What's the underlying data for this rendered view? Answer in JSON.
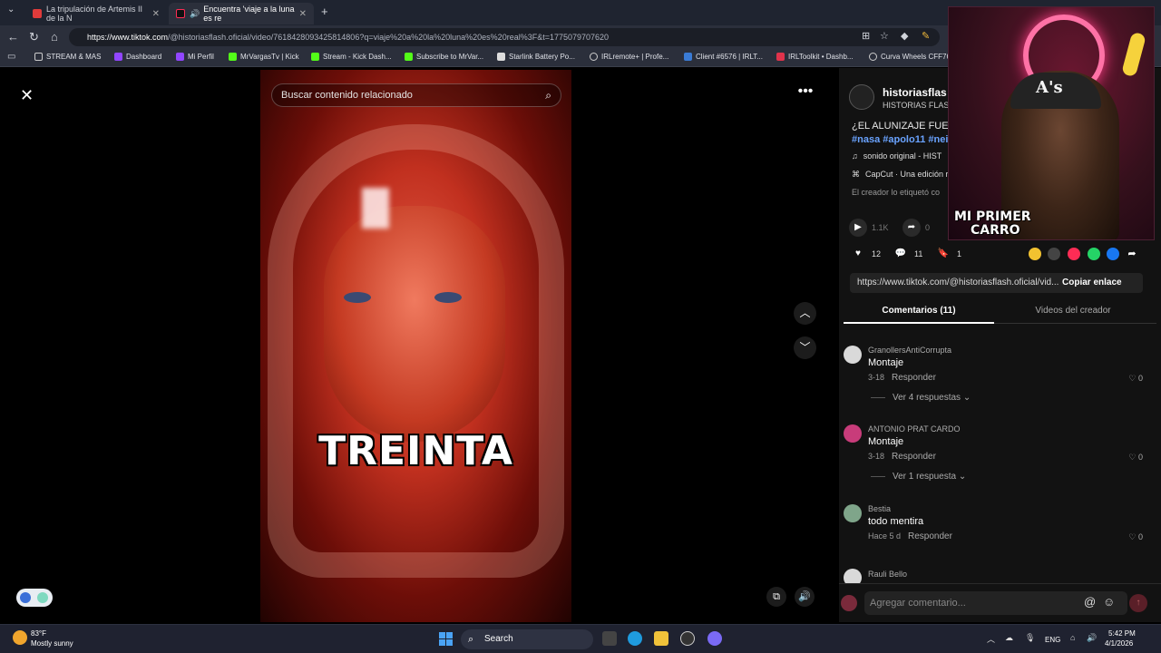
{
  "browser": {
    "tabs": [
      {
        "title": "La tripulación de Artemis II de la N",
        "active": false
      },
      {
        "title": "Encuentra 'viaje a la luna es re",
        "active": true
      }
    ],
    "url_domain": "https://www.tiktok.com",
    "url_path": "/@historiasflash.oficial/video/7618428093425814806?q=viaje%20a%20la%20luna%20es%20real%3F&t=1775079707620",
    "bookmarks": [
      "STREAM & MAS",
      "Dashboard",
      "Mi Perfil",
      "MrVargasTv | Kick",
      "Stream - Kick Dash...",
      "Subscribe to MrVar...",
      "Starlink Battery Po...",
      "IRLremote+ | Profe...",
      "Client #6576 | IRLT...",
      "IRLToolkit • Dashb...",
      "Curva Wheels CFF76"
    ]
  },
  "video": {
    "search_placeholder": "Buscar contenido relacionado",
    "caption": "TREINTA"
  },
  "creator": {
    "name": "historiasflas",
    "subtitle": "HISTORIAS FLAS",
    "description": "¿EL ALUNIZAJE FUE F",
    "hashtags": "#nasa #apolo11 #nei",
    "sound": "sonido original - HIST",
    "capcut": "CapCut · Una edición r",
    "tagged": "El creador lo etiquetó co"
  },
  "stats": {
    "plays": "1.1K",
    "shares": "0",
    "likes": "12",
    "comments": "11",
    "saves": "1"
  },
  "share": {
    "link": "https://www.tiktok.com/@historiasflash.oficial/vid...",
    "copy_label": "Copiar enlace"
  },
  "panel_tabs": {
    "comments": "Comentarios (11)",
    "creator_videos": "Videos del creador"
  },
  "comments": [
    {
      "user": "GranollersAntiCorrupta",
      "text": "Montaje",
      "date": "3-18",
      "reply": "Responder",
      "likes": "0",
      "more": "Ver 4 respuestas ⌄",
      "avatar_color": "#d9d9d9"
    },
    {
      "user": "ANTONIO PRAT CARDO",
      "text": "Montaje",
      "date": "3-18",
      "reply": "Responder",
      "likes": "0",
      "more": "Ver 1 respuesta ⌄",
      "avatar_color": "#c83c7a"
    },
    {
      "user": "Bestia",
      "text": "todo mentira",
      "date": "Hace 5 d",
      "reply": "Responder",
      "likes": "0",
      "more": "",
      "avatar_color": "#7fa58a"
    },
    {
      "user": "Rauli Bello",
      "text": "",
      "date": "",
      "reply": "",
      "likes": "",
      "more": "",
      "avatar_color": "#d9d9d9"
    }
  ],
  "comment_input": {
    "placeholder": "Agregar comentario..."
  },
  "webcam": {
    "title_line1": "MI PRIMER",
    "title_line2": "CARRO",
    "cap_logo": "A's"
  },
  "taskbar": {
    "temp": "83°F",
    "weather": "Mostly sunny",
    "search_label": "Search",
    "lang": "ENG",
    "time": "5:42 PM",
    "date": "4/1/2026"
  },
  "icons": [
    "close-icon",
    "search-icon",
    "more-icon",
    "chevron-up-icon",
    "chevron-down-icon",
    "play-icon",
    "share-icon",
    "heart-icon",
    "comment-icon",
    "bookmark-icon",
    "volume-icon",
    "at-icon",
    "emoji-icon",
    "send-icon"
  ],
  "colors": {
    "tiktok_red": "#fe2c55",
    "hashtag_blue": "#6aa3ff",
    "panel_bg": "#121212"
  }
}
